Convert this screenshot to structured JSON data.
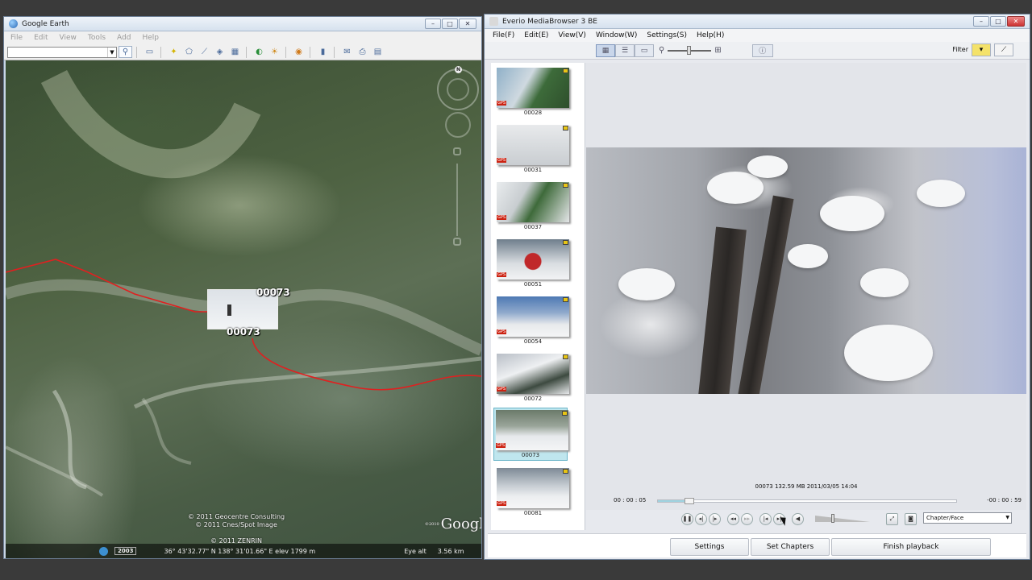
{
  "google_earth": {
    "title": "Google Earth",
    "menu": [
      "File",
      "Edit",
      "View",
      "Tools",
      "Add",
      "Help"
    ],
    "compass_label": "N",
    "placemark": {
      "top_label": "00073",
      "bottom_label": "00073"
    },
    "copyright_lines": [
      "© 2011 Geocentre Consulting",
      "© 2011 Cnes/Spot Image",
      "© 2011 ZENRIN"
    ],
    "logo_text": "Google",
    "logo_small": "©2010",
    "status": {
      "year": "2003",
      "coords": "36° 43'32.77\" N 138° 31'01.66\" E elev 1799 m",
      "eye_alt_label": "Eye alt",
      "eye_alt_value": "3.56 km"
    }
  },
  "media_browser": {
    "title": "Everio MediaBrowser 3 BE",
    "menu": [
      "File(F)",
      "Edit(E)",
      "View(V)",
      "Window(W)",
      "Settings(S)",
      "Help(H)"
    ],
    "filter_label": "Filter",
    "thumbnails": [
      {
        "id": "00028"
      },
      {
        "id": "00031"
      },
      {
        "id": "00037"
      },
      {
        "id": "00051"
      },
      {
        "id": "00054"
      },
      {
        "id": "00072"
      },
      {
        "id": "00073",
        "selected": true
      },
      {
        "id": "00081"
      }
    ],
    "gps_badge": "GPS",
    "file_info": "00073 132.59 MB 2011/03/05 14:04",
    "time_current": "00 : 00 : 05",
    "time_remaining": "-00 : 00 : 59",
    "progress_fraction": 0.09,
    "volume_fraction": 0.32,
    "chapter_select": "Chapter/Face",
    "buttons": {
      "settings": "Settings",
      "set_chapters": "Set Chapters",
      "finish_playback": "Finish playback"
    }
  },
  "colors": {
    "route_red": "#e02020",
    "accent_blue": "#3c8fd1",
    "selected_thumb": "#bfe6ee"
  }
}
